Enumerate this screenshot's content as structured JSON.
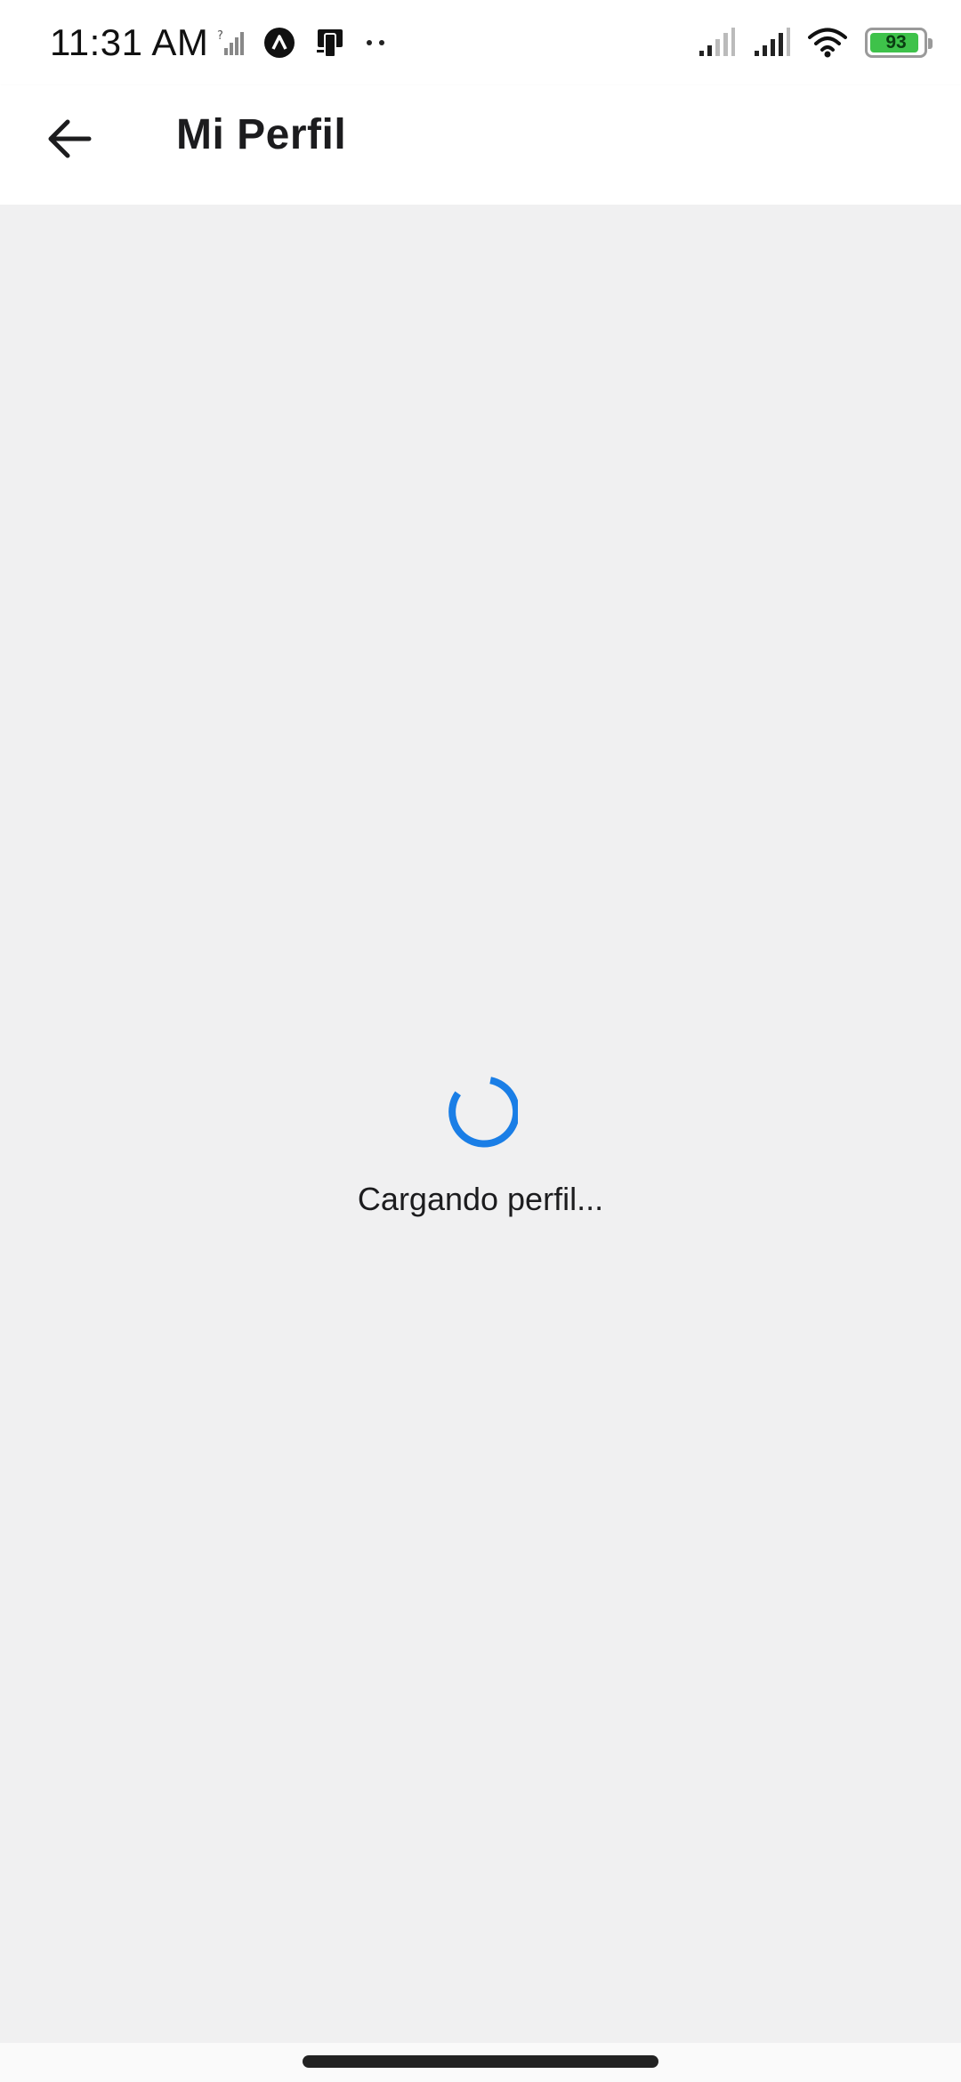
{
  "status_bar": {
    "time": "11:31 AM",
    "left_icons": [
      "no-sim-signal-icon",
      "app-notification-icon",
      "device-notification-icon",
      "more-notifications-icon"
    ],
    "right_icons": [
      "signal-bars-icon",
      "signal-bars-icon",
      "wifi-icon"
    ],
    "battery_level": "93",
    "battery_color": "#3ec24a"
  },
  "app_bar": {
    "back_icon": "arrow-left-icon",
    "title": "Mi Perfil"
  },
  "content": {
    "spinner_color": "#1a7ee6",
    "loading_text": "Cargando perfil..."
  }
}
